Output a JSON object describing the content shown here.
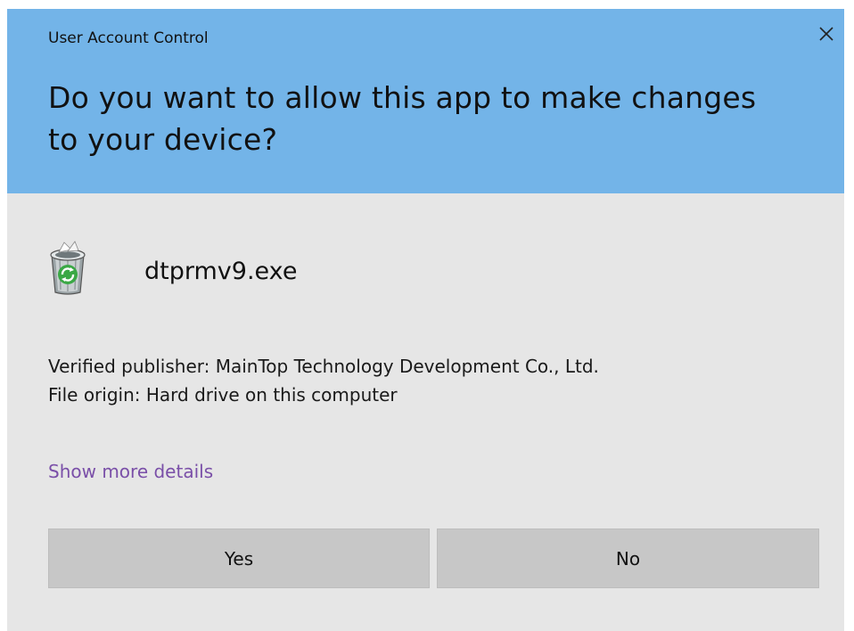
{
  "dialog": {
    "caption": "User Account Control",
    "close_icon": "close-icon",
    "title": "Do you want to allow this app to make changes to your device?",
    "app": {
      "icon": "recycle-bin-icon",
      "name": "dtprmv9.exe"
    },
    "publisher_line": "Verified publisher: MainTop Technology Development Co., Ltd.",
    "origin_line": "File origin: Hard drive on this computer",
    "details_link": "Show more details",
    "buttons": {
      "yes": "Yes",
      "no": "No"
    }
  },
  "colors": {
    "header": "#73b4e8",
    "body": "#e6e6e6",
    "button": "#c7c7c7",
    "link": "#7a4fa8"
  }
}
